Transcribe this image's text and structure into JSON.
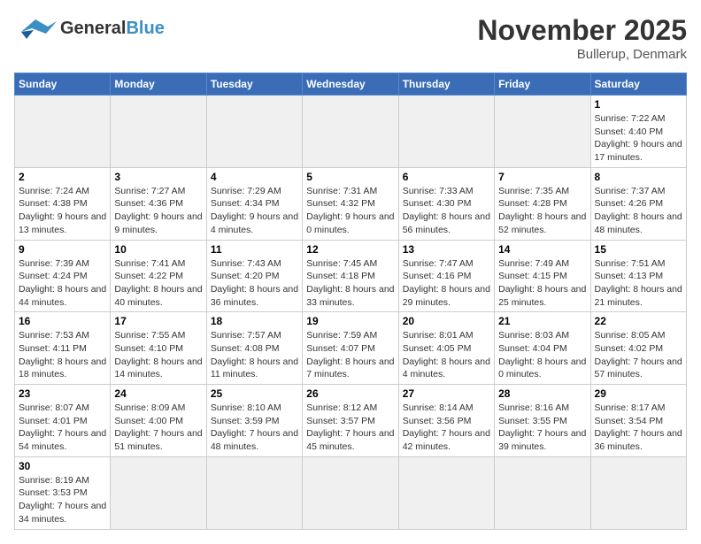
{
  "logo": {
    "general": "General",
    "blue": "Blue"
  },
  "header": {
    "title": "November 2025",
    "location": "Bullerup, Denmark"
  },
  "weekdays": [
    "Sunday",
    "Monday",
    "Tuesday",
    "Wednesday",
    "Thursday",
    "Friday",
    "Saturday"
  ],
  "weeks": [
    [
      {
        "day": "",
        "empty": true
      },
      {
        "day": "",
        "empty": true
      },
      {
        "day": "",
        "empty": true
      },
      {
        "day": "",
        "empty": true
      },
      {
        "day": "",
        "empty": true
      },
      {
        "day": "",
        "empty": true
      },
      {
        "day": "1",
        "sunrise": "Sunrise: 7:22 AM",
        "sunset": "Sunset: 4:40 PM",
        "daylight": "Daylight: 9 hours and 17 minutes."
      }
    ],
    [
      {
        "day": "2",
        "sunrise": "Sunrise: 7:24 AM",
        "sunset": "Sunset: 4:38 PM",
        "daylight": "Daylight: 9 hours and 13 minutes."
      },
      {
        "day": "3",
        "sunrise": "Sunrise: 7:27 AM",
        "sunset": "Sunset: 4:36 PM",
        "daylight": "Daylight: 9 hours and 9 minutes."
      },
      {
        "day": "4",
        "sunrise": "Sunrise: 7:29 AM",
        "sunset": "Sunset: 4:34 PM",
        "daylight": "Daylight: 9 hours and 4 minutes."
      },
      {
        "day": "5",
        "sunrise": "Sunrise: 7:31 AM",
        "sunset": "Sunset: 4:32 PM",
        "daylight": "Daylight: 9 hours and 0 minutes."
      },
      {
        "day": "6",
        "sunrise": "Sunrise: 7:33 AM",
        "sunset": "Sunset: 4:30 PM",
        "daylight": "Daylight: 8 hours and 56 minutes."
      },
      {
        "day": "7",
        "sunrise": "Sunrise: 7:35 AM",
        "sunset": "Sunset: 4:28 PM",
        "daylight": "Daylight: 8 hours and 52 minutes."
      },
      {
        "day": "8",
        "sunrise": "Sunrise: 7:37 AM",
        "sunset": "Sunset: 4:26 PM",
        "daylight": "Daylight: 8 hours and 48 minutes."
      }
    ],
    [
      {
        "day": "9",
        "sunrise": "Sunrise: 7:39 AM",
        "sunset": "Sunset: 4:24 PM",
        "daylight": "Daylight: 8 hours and 44 minutes."
      },
      {
        "day": "10",
        "sunrise": "Sunrise: 7:41 AM",
        "sunset": "Sunset: 4:22 PM",
        "daylight": "Daylight: 8 hours and 40 minutes."
      },
      {
        "day": "11",
        "sunrise": "Sunrise: 7:43 AM",
        "sunset": "Sunset: 4:20 PM",
        "daylight": "Daylight: 8 hours and 36 minutes."
      },
      {
        "day": "12",
        "sunrise": "Sunrise: 7:45 AM",
        "sunset": "Sunset: 4:18 PM",
        "daylight": "Daylight: 8 hours and 33 minutes."
      },
      {
        "day": "13",
        "sunrise": "Sunrise: 7:47 AM",
        "sunset": "Sunset: 4:16 PM",
        "daylight": "Daylight: 8 hours and 29 minutes."
      },
      {
        "day": "14",
        "sunrise": "Sunrise: 7:49 AM",
        "sunset": "Sunset: 4:15 PM",
        "daylight": "Daylight: 8 hours and 25 minutes."
      },
      {
        "day": "15",
        "sunrise": "Sunrise: 7:51 AM",
        "sunset": "Sunset: 4:13 PM",
        "daylight": "Daylight: 8 hours and 21 minutes."
      }
    ],
    [
      {
        "day": "16",
        "sunrise": "Sunrise: 7:53 AM",
        "sunset": "Sunset: 4:11 PM",
        "daylight": "Daylight: 8 hours and 18 minutes."
      },
      {
        "day": "17",
        "sunrise": "Sunrise: 7:55 AM",
        "sunset": "Sunset: 4:10 PM",
        "daylight": "Daylight: 8 hours and 14 minutes."
      },
      {
        "day": "18",
        "sunrise": "Sunrise: 7:57 AM",
        "sunset": "Sunset: 4:08 PM",
        "daylight": "Daylight: 8 hours and 11 minutes."
      },
      {
        "day": "19",
        "sunrise": "Sunrise: 7:59 AM",
        "sunset": "Sunset: 4:07 PM",
        "daylight": "Daylight: 8 hours and 7 minutes."
      },
      {
        "day": "20",
        "sunrise": "Sunrise: 8:01 AM",
        "sunset": "Sunset: 4:05 PM",
        "daylight": "Daylight: 8 hours and 4 minutes."
      },
      {
        "day": "21",
        "sunrise": "Sunrise: 8:03 AM",
        "sunset": "Sunset: 4:04 PM",
        "daylight": "Daylight: 8 hours and 0 minutes."
      },
      {
        "day": "22",
        "sunrise": "Sunrise: 8:05 AM",
        "sunset": "Sunset: 4:02 PM",
        "daylight": "Daylight: 7 hours and 57 minutes."
      }
    ],
    [
      {
        "day": "23",
        "sunrise": "Sunrise: 8:07 AM",
        "sunset": "Sunset: 4:01 PM",
        "daylight": "Daylight: 7 hours and 54 minutes."
      },
      {
        "day": "24",
        "sunrise": "Sunrise: 8:09 AM",
        "sunset": "Sunset: 4:00 PM",
        "daylight": "Daylight: 7 hours and 51 minutes."
      },
      {
        "day": "25",
        "sunrise": "Sunrise: 8:10 AM",
        "sunset": "Sunset: 3:59 PM",
        "daylight": "Daylight: 7 hours and 48 minutes."
      },
      {
        "day": "26",
        "sunrise": "Sunrise: 8:12 AM",
        "sunset": "Sunset: 3:57 PM",
        "daylight": "Daylight: 7 hours and 45 minutes."
      },
      {
        "day": "27",
        "sunrise": "Sunrise: 8:14 AM",
        "sunset": "Sunset: 3:56 PM",
        "daylight": "Daylight: 7 hours and 42 minutes."
      },
      {
        "day": "28",
        "sunrise": "Sunrise: 8:16 AM",
        "sunset": "Sunset: 3:55 PM",
        "daylight": "Daylight: 7 hours and 39 minutes."
      },
      {
        "day": "29",
        "sunrise": "Sunrise: 8:17 AM",
        "sunset": "Sunset: 3:54 PM",
        "daylight": "Daylight: 7 hours and 36 minutes."
      }
    ],
    [
      {
        "day": "30",
        "sunrise": "Sunrise: 8:19 AM",
        "sunset": "Sunset: 3:53 PM",
        "daylight": "Daylight: 7 hours and 34 minutes."
      },
      {
        "day": "",
        "empty": true
      },
      {
        "day": "",
        "empty": true
      },
      {
        "day": "",
        "empty": true
      },
      {
        "day": "",
        "empty": true
      },
      {
        "day": "",
        "empty": true
      },
      {
        "day": "",
        "empty": true
      }
    ]
  ]
}
